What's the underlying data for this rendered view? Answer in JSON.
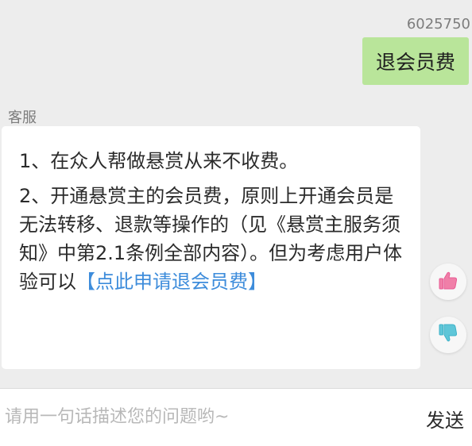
{
  "header": {
    "user_id": "6025750"
  },
  "user_message": {
    "text": "退会员费"
  },
  "agent": {
    "label": "客服",
    "paragraph1": "1、在众人帮做悬赏从来不收费。",
    "paragraph2_text": "2、开通悬赏主的会员费，原则上开通会员是无法转移、退款等操作的（见《悬赏主服务须知》中第2.1条例全部内容）。但为考虑用户体验可以",
    "paragraph2_link": "【点此申请退会员费】"
  },
  "reactions": {
    "up_icon": "thumbs-up-icon",
    "down_icon": "thumbs-down-icon"
  },
  "colors": {
    "link": "#3d8cdb",
    "user_bubble": "#b9e59a",
    "thumb_up": "#f07fa8",
    "thumb_down": "#5fc6d8"
  },
  "input": {
    "placeholder": "请用一句话描述您的问题哟~",
    "value": ""
  },
  "send": {
    "label": "发送"
  }
}
